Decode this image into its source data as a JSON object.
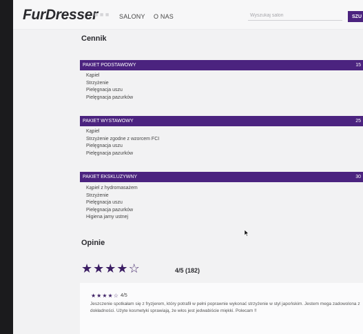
{
  "header": {
    "logo": "FurDresser",
    "nav": [
      "SALONY",
      "O NAS"
    ],
    "search_placeholder": "Wyszukaj salon",
    "search_button": "SZU"
  },
  "pricing": {
    "title": "Cennik",
    "packages": [
      {
        "name": "PAKIET PODSTAWOWY",
        "price": "15",
        "items": [
          "Kąpiel",
          "Strzyżenie",
          "Pielęgnacja uszu",
          "Pielęgnacja pazurków"
        ]
      },
      {
        "name": "PAKIET WYSTAWOWY",
        "price": "25",
        "items": [
          "Kąpiel",
          "Strzyżenie zgodne z wzorcem FCI",
          "Pielęgnacja uszu",
          "Pielęgnacja pazurków"
        ]
      },
      {
        "name": "PAKIET EKSKLUZYWNY",
        "price": "30",
        "items": [
          "Kąpiel z hydromasażem",
          "Strzyżenie",
          "Pielęgnacja uszu",
          "Pielęgnacja pazurków",
          "Higiena jamy ustnej"
        ]
      }
    ]
  },
  "reviews": {
    "title": "Opinie",
    "overall_stars": 4,
    "overall_summary": "4/5 (182)",
    "items": [
      {
        "stars": 4,
        "score": "4/5",
        "text": "Jeszczenie spotkałam się z fryzjerem, który potrafił w pełni poprawnie wykonać strzyżenie w styl japońskim. Jestem mega zadowolona z dokładności. Użyte kosmetyki sprawiają, że włos jest jedwabiście miękki. Polecam !!"
      }
    ]
  },
  "colors": {
    "accent": "#4b237f",
    "star": "#3b1d63",
    "page_bg": "#f2f2f3",
    "outer_bg": "#1b1b1d"
  }
}
